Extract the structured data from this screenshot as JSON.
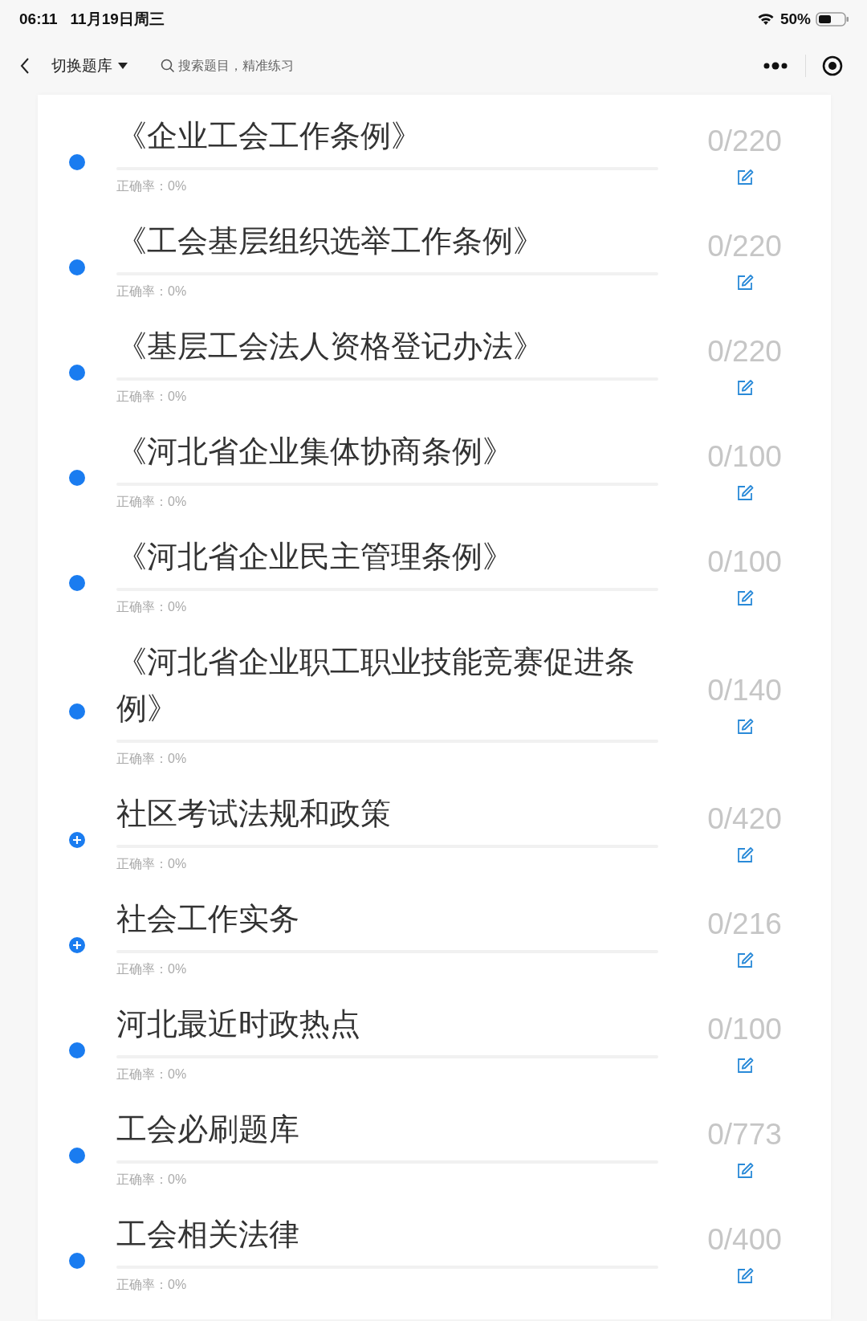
{
  "status_bar": {
    "time": "06:11",
    "date": "11月19日周三",
    "battery": "50%"
  },
  "nav_bar": {
    "title": "切换题库",
    "search": {
      "placeholder": "搜索题目，精准练习"
    }
  },
  "banks": [
    {
      "kind": "dot",
      "title": "《企业工会工作条例》",
      "count": "0/220",
      "level": 0,
      "accuracy": "正确率：0%"
    },
    {
      "kind": "dot",
      "title": "《工会基层组织选举工作条例》",
      "count": "0/220",
      "level": 0,
      "accuracy": "正确率：0%"
    },
    {
      "kind": "dot",
      "title": "《基层工会法人资格登记办法》",
      "count": "0/220",
      "level": 0,
      "accuracy": "正确率：0%"
    },
    {
      "kind": "dot",
      "title": "《河北省企业集体协商条例》",
      "count": "0/100",
      "level": 0,
      "accuracy": "正确率：0%"
    },
    {
      "kind": "dot",
      "title": "《河北省企业民主管理条例》",
      "count": "0/100",
      "level": 0,
      "accuracy": "正确率：0%"
    },
    {
      "kind": "dot",
      "title": "《河北省企业职工职业技能竞赛促进条例》",
      "count": "0/140",
      "level": 0,
      "accuracy": "正确率：0%"
    },
    {
      "kind": "plus",
      "title": "社区考试法规和政策",
      "count": "0/420",
      "level": 0,
      "accuracy": "正确率：0%"
    },
    {
      "kind": "plus",
      "title": "社会工作实务",
      "count": "0/216",
      "level": 0,
      "accuracy": "正确率：0%"
    },
    {
      "kind": "dot",
      "title": "河北最近时政热点",
      "count": "0/100",
      "level": 0,
      "accuracy": "正确率：0%"
    },
    {
      "kind": "dot",
      "title": "工会必刷题库",
      "count": "0/773",
      "level": 0,
      "accuracy": "正确率：0%"
    },
    {
      "kind": "dot",
      "title": "工会相关法律",
      "count": "0/400",
      "level": 0,
      "accuracy": "正确率：0%"
    }
  ]
}
